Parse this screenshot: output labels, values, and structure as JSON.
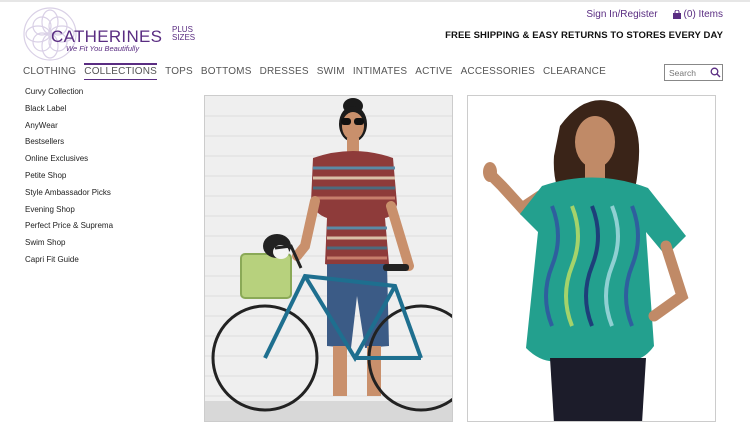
{
  "brand": {
    "name": "CATHERINES",
    "plus_sizes": "PLUS SIZES",
    "tagline": "We Fit You Beautifully"
  },
  "account": {
    "sign_in": "Sign In/Register",
    "bag": "(0) Items"
  },
  "promo": "FREE SHIPPING & EASY RETURNS TO STORES EVERY DAY",
  "nav": [
    {
      "label": "CLOTHING"
    },
    {
      "label": "COLLECTIONS"
    },
    {
      "label": "TOPS"
    },
    {
      "label": "BOTTOMS"
    },
    {
      "label": "DRESSES"
    },
    {
      "label": "SWIM"
    },
    {
      "label": "INTIMATES"
    },
    {
      "label": "ACTIVE"
    },
    {
      "label": "ACCESSORIES"
    },
    {
      "label": "CLEARANCE"
    }
  ],
  "search": {
    "placeholder": "Search"
  },
  "sidebar": [
    "Curvy Collection",
    "Black Label",
    "AnyWear",
    "Bestsellers",
    "Online Exclusives",
    "Petite Shop",
    "Style Ambassador Picks",
    "Evening Shop",
    "Perfect Price & Suprema",
    "Swim Shop",
    "Capri Fit Guide"
  ],
  "colors": {
    "brand_purple": "#5a2d82"
  }
}
